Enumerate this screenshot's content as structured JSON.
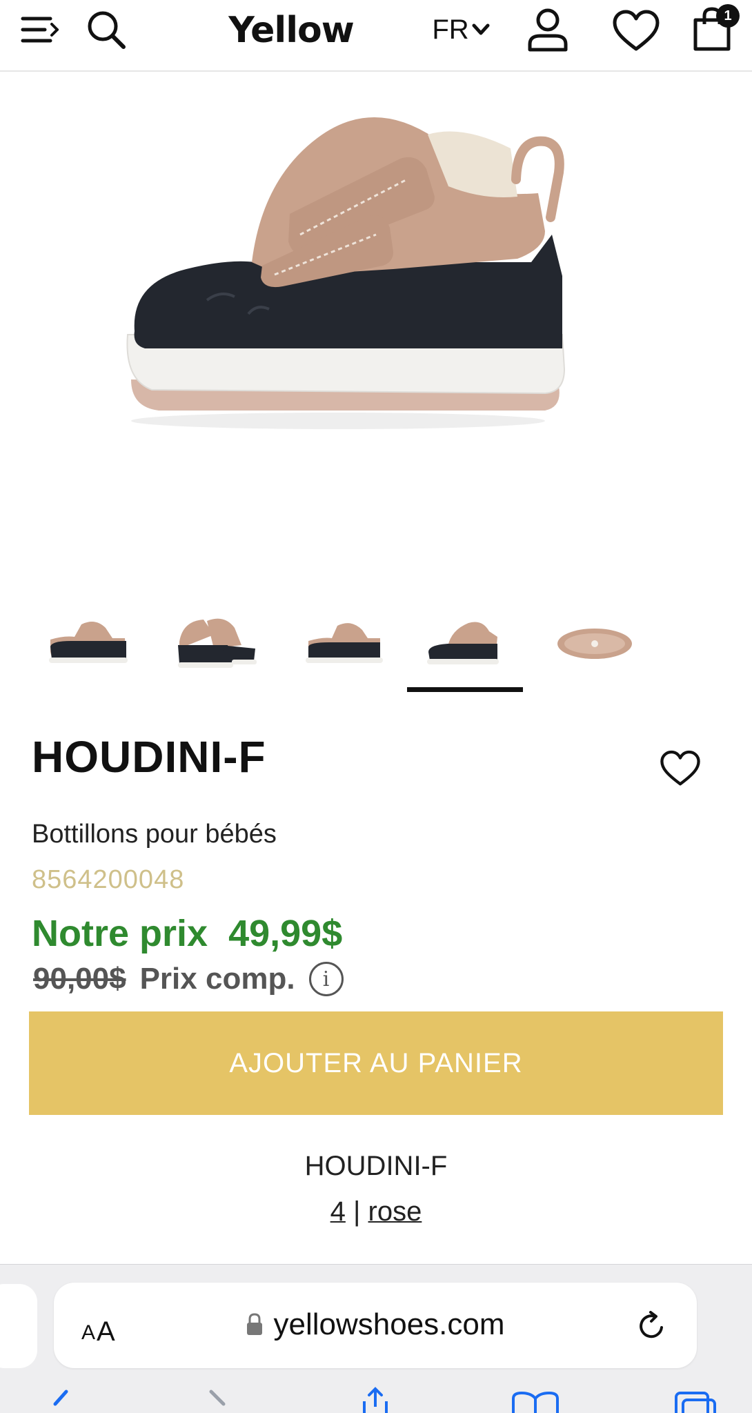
{
  "header": {
    "logo": "Yellow",
    "lang": "FR",
    "cart_count": "1",
    "icons": [
      "menu-icon",
      "search-icon",
      "chevron-down-icon",
      "user-icon",
      "heart-icon",
      "shopping-bag-icon"
    ]
  },
  "colors": {
    "price_green": "#2f8a2f",
    "button_yellow": "#e5c466",
    "sku_color": "#cfc08a",
    "shoe_tan": "#c9a28c",
    "shoe_navy": "#22262e"
  },
  "product": {
    "name": "HOUDINI-F",
    "description": "Bottillons pour bébés",
    "sku": "8564200048",
    "price_label": "Notre prix",
    "price": "49,99$",
    "old_price": "90,00$",
    "compare_label": "Prix comp.",
    "info_symbol": "i",
    "add_to_cart": "AJOUTER AU PANIER",
    "thumbnail_count": 5,
    "active_thumbnail": 4
  },
  "variant": {
    "name": "HOUDINI-F",
    "size": "4",
    "separator": "|",
    "color": "rose"
  },
  "browser": {
    "aa_small": "A",
    "aa_large": "A",
    "url": "yellowshoes.com",
    "icons": [
      "lock-icon",
      "reload-icon",
      "back-icon",
      "forward-icon",
      "share-icon",
      "bookmarks-icon",
      "tabs-icon"
    ]
  }
}
